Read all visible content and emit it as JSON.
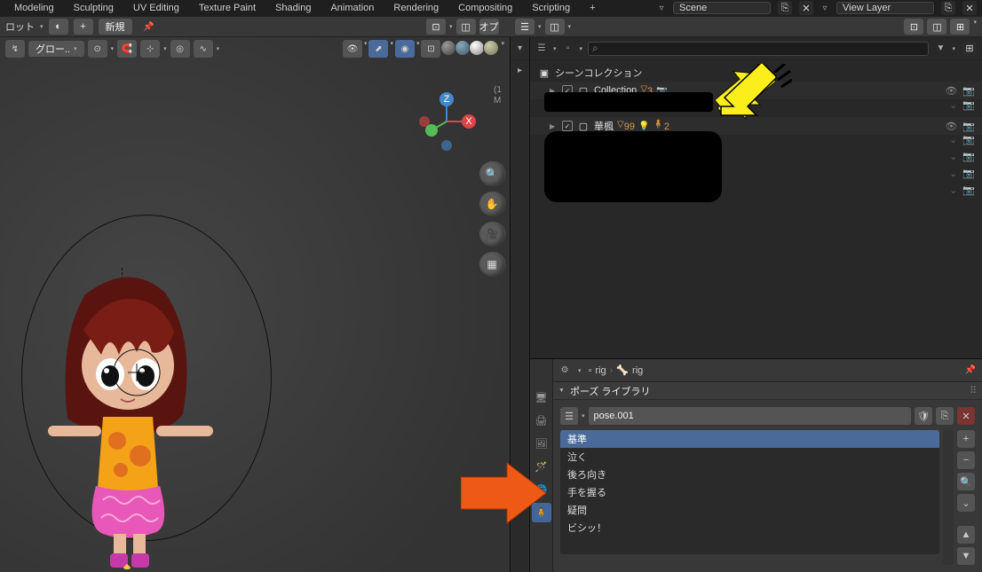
{
  "tabs": [
    "Modeling",
    "Sculpting",
    "UV Editing",
    "Texture Paint",
    "Shading",
    "Animation",
    "Rendering",
    "Compositing",
    "Scripting"
  ],
  "scene_field": "Scene",
  "layer_field": "View Layer",
  "row2": {
    "pivot": "ロット",
    "new": "新規"
  },
  "viewport": {
    "orient": "グロー..",
    "axes": {
      "x": "X",
      "y": "Y",
      "z": "Z"
    }
  },
  "outliner": {
    "title": "シーンコレクション",
    "collection": "Collection",
    "coll_badge1": "3",
    "item2": "華楓",
    "item2_badge": "99",
    "item2_badge2": "2"
  },
  "props": {
    "crumb1": "rig",
    "crumb2": "rig",
    "panel_title": "ポーズ ライブラリ",
    "action": "pose.001",
    "poses": [
      "基準",
      "泣く",
      "後ろ向き",
      "手を握る",
      "疑問",
      "ビシッ！"
    ]
  }
}
